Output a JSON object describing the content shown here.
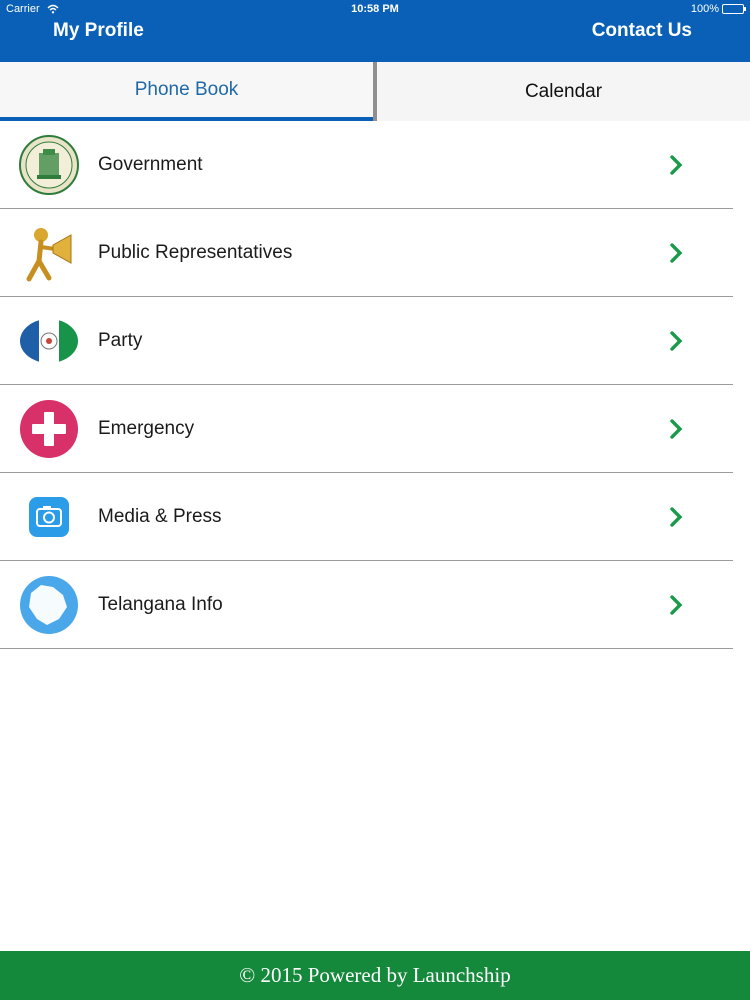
{
  "status_bar": {
    "carrier": "Carrier",
    "time": "10:58 PM",
    "battery": "100%"
  },
  "header": {
    "left_button": "My Profile",
    "right_button": "Contact Us",
    "background_color": "#0960b6"
  },
  "tabs": [
    {
      "label": "Phone Book",
      "active": true
    },
    {
      "label": "Calendar",
      "active": false
    }
  ],
  "list": {
    "items": [
      {
        "label": "Government",
        "icon": "government-emblem-icon"
      },
      {
        "label": "Public Representatives",
        "icon": "megaphone-figure-icon"
      },
      {
        "label": "Party",
        "icon": "party-flag-icon"
      },
      {
        "label": "Emergency",
        "icon": "medical-cross-icon"
      },
      {
        "label": "Media & Press",
        "icon": "camera-icon"
      },
      {
        "label": "Telangana Info",
        "icon": "state-map-icon"
      }
    ],
    "chevron_color": "#1a9a4a"
  },
  "footer": {
    "text": "© 2015 Powered by Launchship",
    "background_color": "#14883b"
  }
}
